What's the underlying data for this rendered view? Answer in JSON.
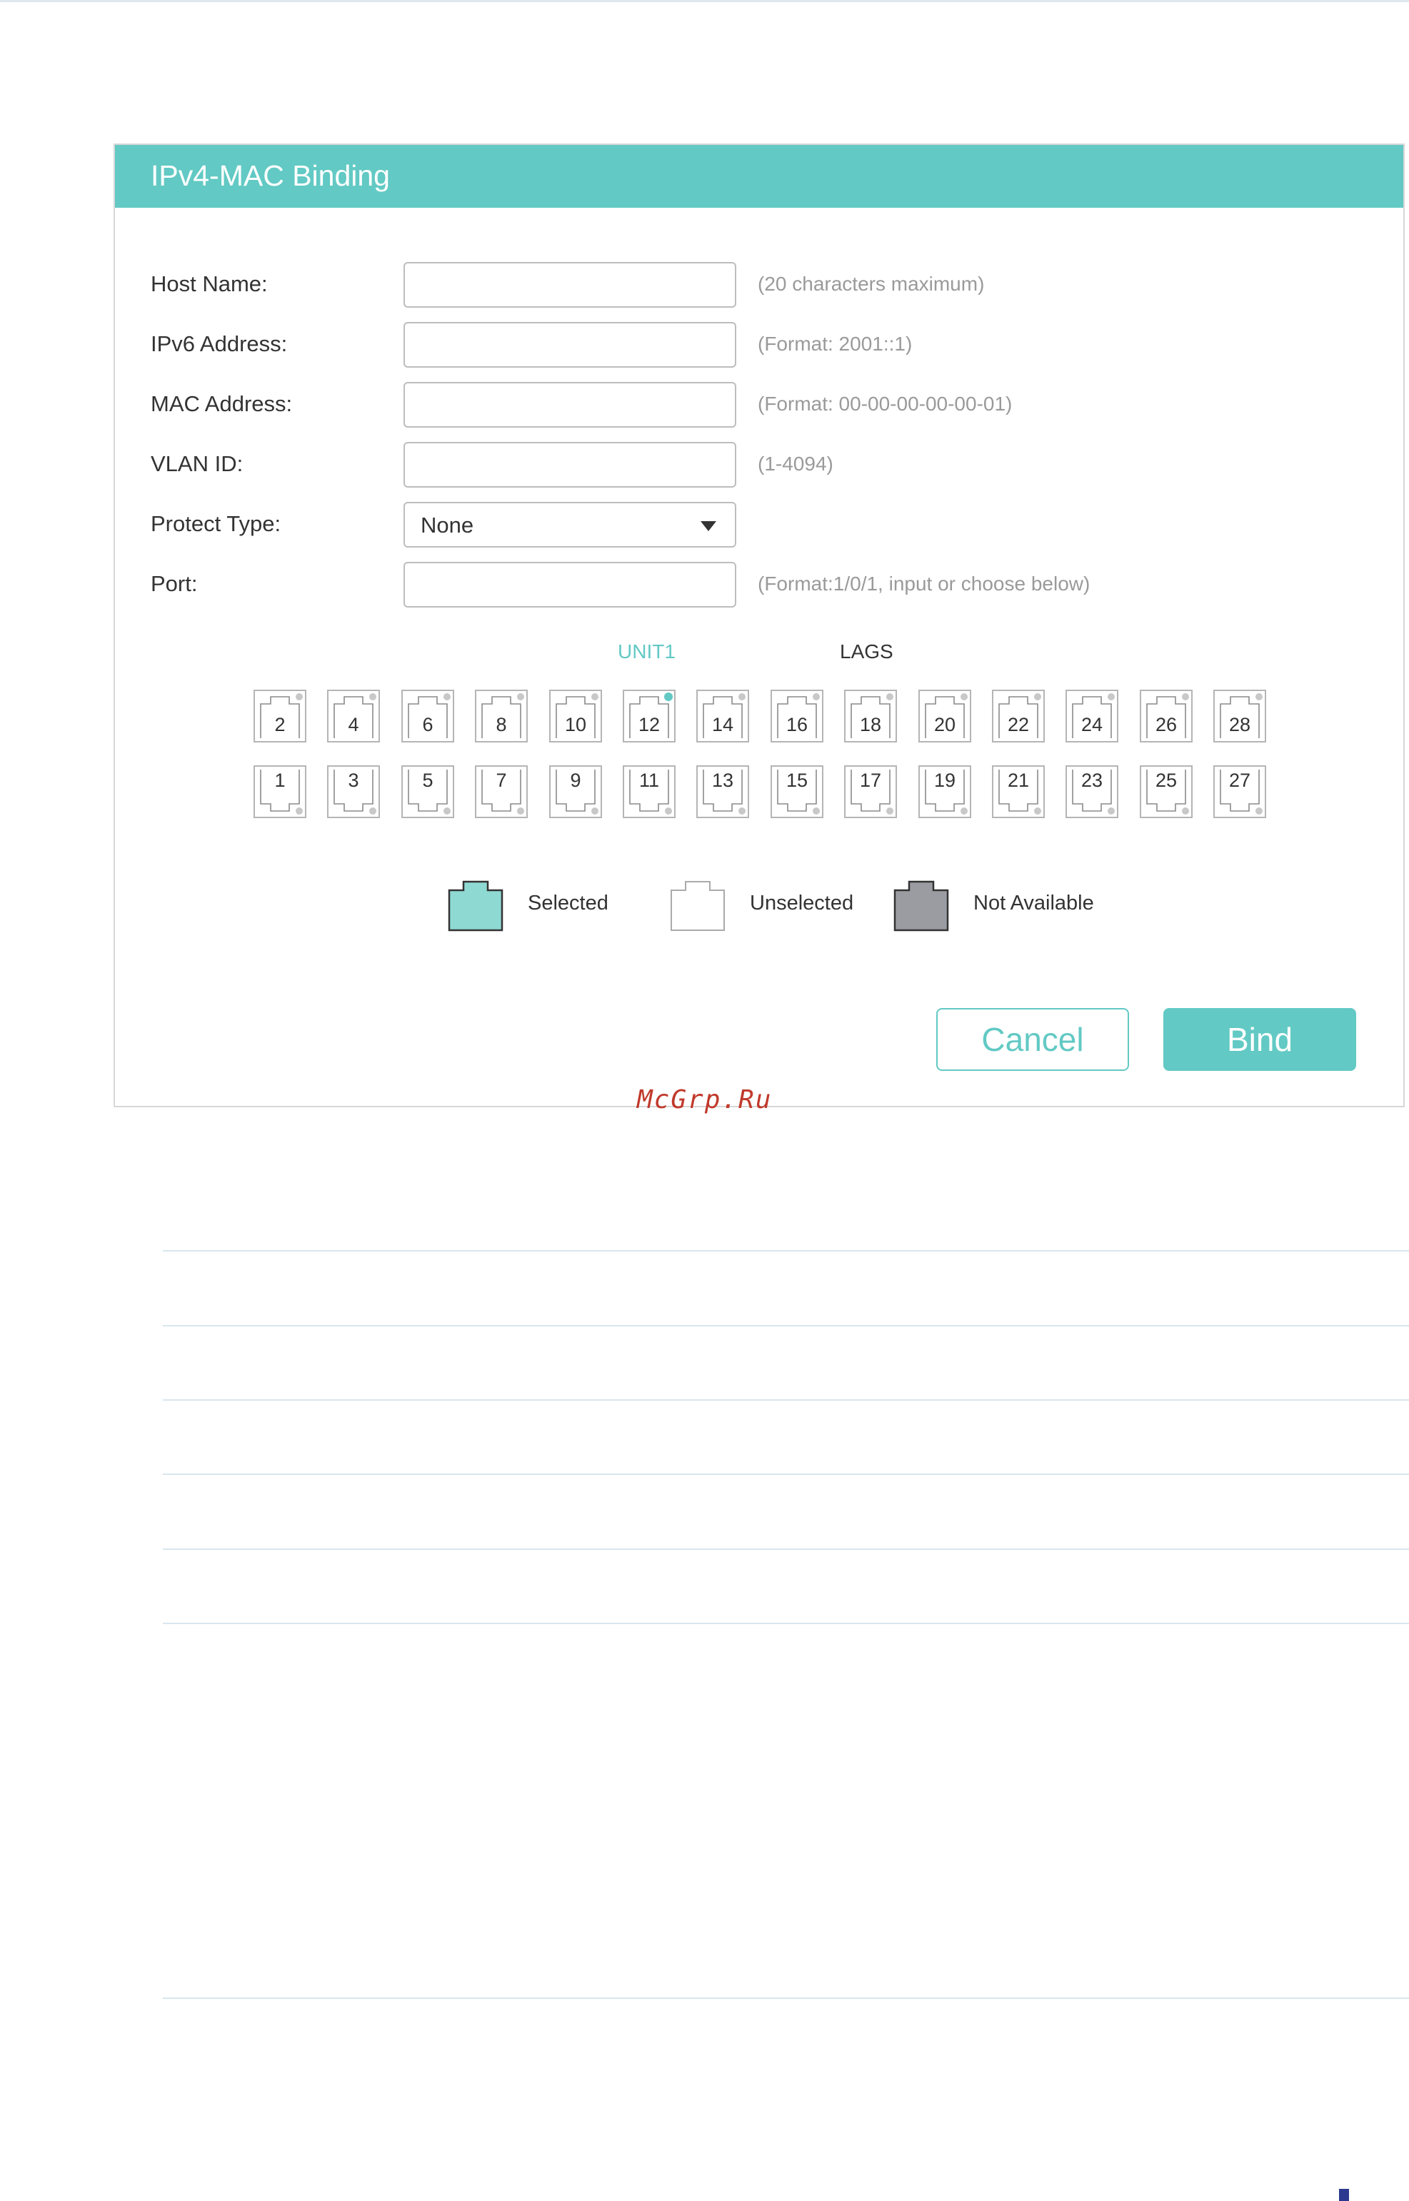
{
  "dialog": {
    "title": "IPv4-MAC Binding",
    "fields": {
      "host_name": {
        "label": "Host Name:",
        "value": "",
        "hint": "(20 characters maximum)"
      },
      "ipv6": {
        "label": "IPv6 Address:",
        "value": "",
        "hint": "(Format: 2001::1)"
      },
      "mac": {
        "label": "MAC Address:",
        "value": "",
        "hint": "(Format: 00-00-00-00-00-01)"
      },
      "vlan": {
        "label": "VLAN ID:",
        "value": "",
        "hint": "(1-4094)"
      },
      "protect_type": {
        "label": "Protect Type:",
        "value": "None"
      },
      "port": {
        "label": "Port:",
        "value": "",
        "hint": "(Format:1/0/1, input or choose below)"
      }
    },
    "tabs": {
      "unit": "UNIT1",
      "lags": "LAGS"
    },
    "ports_top": [
      "2",
      "4",
      "6",
      "8",
      "10",
      "12",
      "14",
      "16",
      "18",
      "20",
      "22",
      "24",
      "26",
      "28"
    ],
    "ports_bottom": [
      "1",
      "3",
      "5",
      "7",
      "9",
      "11",
      "13",
      "15",
      "17",
      "19",
      "21",
      "23",
      "25",
      "27"
    ],
    "legend": {
      "selected": "Selected",
      "unselected": "Unselected",
      "not_available": "Not Available"
    },
    "buttons": {
      "cancel": "Cancel",
      "bind": "Bind"
    }
  },
  "watermark": "McGrp.Ru",
  "colors": {
    "accent": "#62c9c4",
    "selected_fill": "#8fd9d3",
    "not_available_fill": "#9a9ca2",
    "status_dot_active": "#62c9c4",
    "status_dot_inactive": "#c8c8c8"
  }
}
